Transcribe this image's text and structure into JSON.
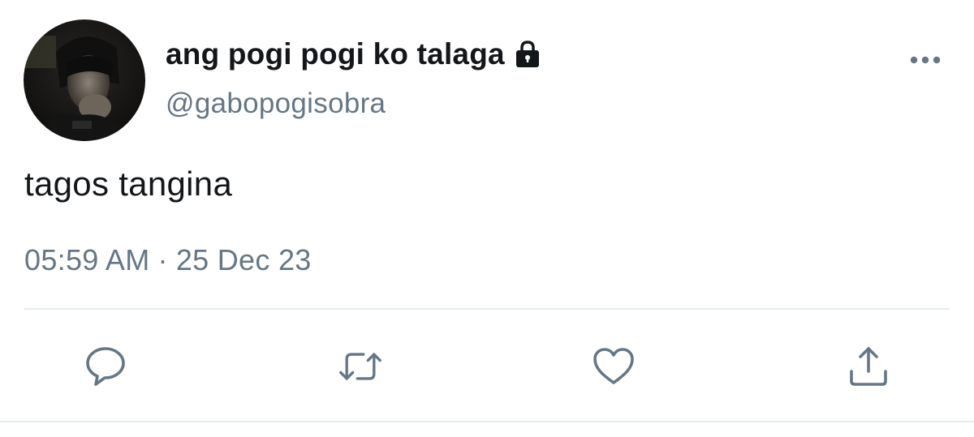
{
  "user": {
    "display_name": "ang pogi pogi ko talaga",
    "handle": "@gabopogisobra",
    "protected_icon": "lock-icon"
  },
  "tweet": {
    "text": "tagos tangina",
    "time": "05:59 AM",
    "separator": "·",
    "date": "25 Dec 23"
  },
  "actions": [
    {
      "name": "reply",
      "icon": "comment-icon"
    },
    {
      "name": "retweet",
      "icon": "retweet-icon"
    },
    {
      "name": "like",
      "icon": "heart-icon"
    },
    {
      "name": "share",
      "icon": "share-icon"
    }
  ],
  "colors": {
    "text_primary": "#14171a",
    "text_secondary": "#657786",
    "icon": "#657786",
    "divider": "#e6ecf0"
  }
}
